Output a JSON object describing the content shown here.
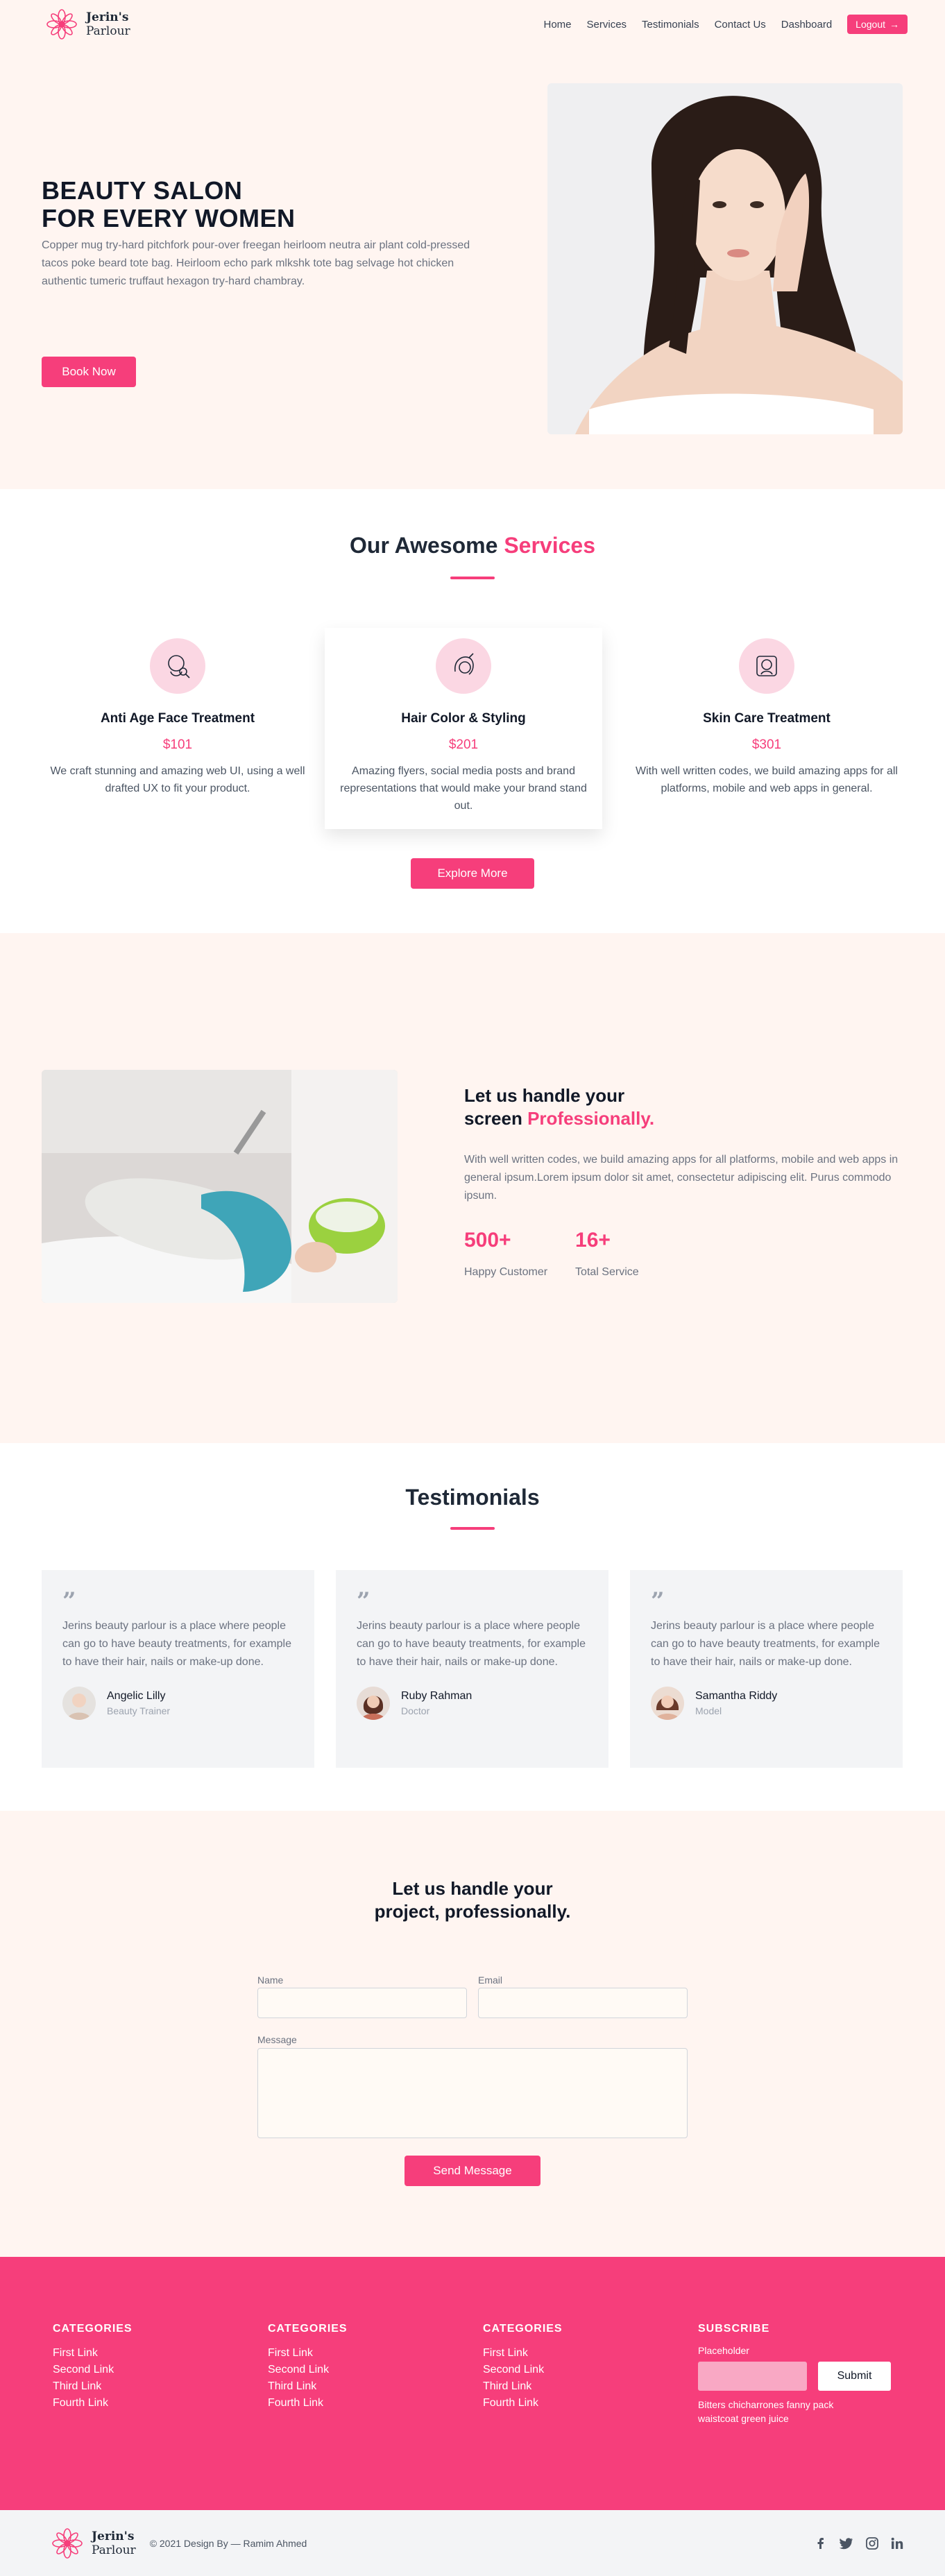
{
  "brand": {
    "name": "Jerin's",
    "subname": "Parlour",
    "accent": "#f63e7b"
  },
  "nav": {
    "items": [
      "Home",
      "Services",
      "Testimonials",
      "Contact Us",
      "Dashboard"
    ],
    "logout_label": "Logout"
  },
  "hero": {
    "title_line1": "BEAUTY SALON",
    "title_line2": "FOR EVERY WOMEN",
    "description": "Copper mug try-hard pitchfork pour-over freegan heirloom neutra air plant cold-pressed tacos poke beard tote bag. Heirloom echo park mlkshk tote bag selvage hot chicken authentic tumeric truffaut hexagon try-hard chambray.",
    "cta": "Book Now"
  },
  "services": {
    "title_plain": "Our Awesome ",
    "title_highlight": "Services",
    "items": [
      {
        "name": "Anti Age Face Treatment",
        "price": "$101",
        "description": "We craft stunning and amazing web UI, using a well drafted UX to fit your product.",
        "icon": "face-treatment-icon"
      },
      {
        "name": "Hair Color & Styling",
        "price": "$201",
        "description": "Amazing flyers, social media posts and brand representations that would make your brand stand out.",
        "icon": "hair-styling-icon"
      },
      {
        "name": "Skin Care Treatment",
        "price": "$301",
        "description": "With well written codes, we build amazing apps for all platforms, mobile and web apps in general.",
        "icon": "skin-care-icon"
      }
    ],
    "cta": "Explore More"
  },
  "about": {
    "title_line1": "Let us handle your",
    "title_line2_plain": "screen ",
    "title_line2_highlight": "Professionally.",
    "description": "With well written codes, we build amazing apps for all platforms, mobile and web apps in general ipsum.Lorem ipsum dolor sit amet, consectetur adipiscing elit. Purus commodo ipsum.",
    "stats": [
      {
        "value": "500+",
        "label": "Happy Customer"
      },
      {
        "value": "16+",
        "label": "Total Service"
      }
    ]
  },
  "testimonials": {
    "title": "Testimonials",
    "quote_mark": "”",
    "items": [
      {
        "text": "Jerins beauty parlour is a place where people can go to have beauty treatments, for example to have their hair, nails or make-up done.",
        "name": "Angelic Lilly",
        "role": "Beauty Trainer"
      },
      {
        "text": "Jerins beauty parlour is a place where people can go to have beauty treatments, for example to have their hair, nails or make-up done.",
        "name": "Ruby Rahman",
        "role": "Doctor"
      },
      {
        "text": "Jerins beauty parlour is a place where people can go to have beauty treatments, for example to have their hair, nails or make-up done.",
        "name": "Samantha Riddy",
        "role": "Model"
      }
    ]
  },
  "contact": {
    "title_line1": "Let us handle your",
    "title_line2": "project, professionally.",
    "name_label": "Name",
    "email_label": "Email",
    "message_label": "Message",
    "name_value": "",
    "email_value": "",
    "message_value": "",
    "submit": "Send Message"
  },
  "footer": {
    "columns": [
      {
        "heading": "CATEGORIES",
        "links": [
          "First Link",
          "Second Link",
          "Third Link",
          "Fourth Link"
        ]
      },
      {
        "heading": "CATEGORIES",
        "links": [
          "First Link",
          "Second Link",
          "Third Link",
          "Fourth Link"
        ]
      },
      {
        "heading": "CATEGORIES",
        "links": [
          "First Link",
          "Second Link",
          "Third Link",
          "Fourth Link"
        ]
      }
    ],
    "subscribe": {
      "heading": "SUBSCRIBE",
      "label": "Placeholder",
      "button": "Submit",
      "note": "Bitters chicharrones fanny pack waistcoat green juice"
    },
    "copyright": "© 2021 Design By — Ramim Ahmed",
    "socials": [
      "facebook-icon",
      "twitter-icon",
      "instagram-icon",
      "linkedin-icon"
    ]
  }
}
